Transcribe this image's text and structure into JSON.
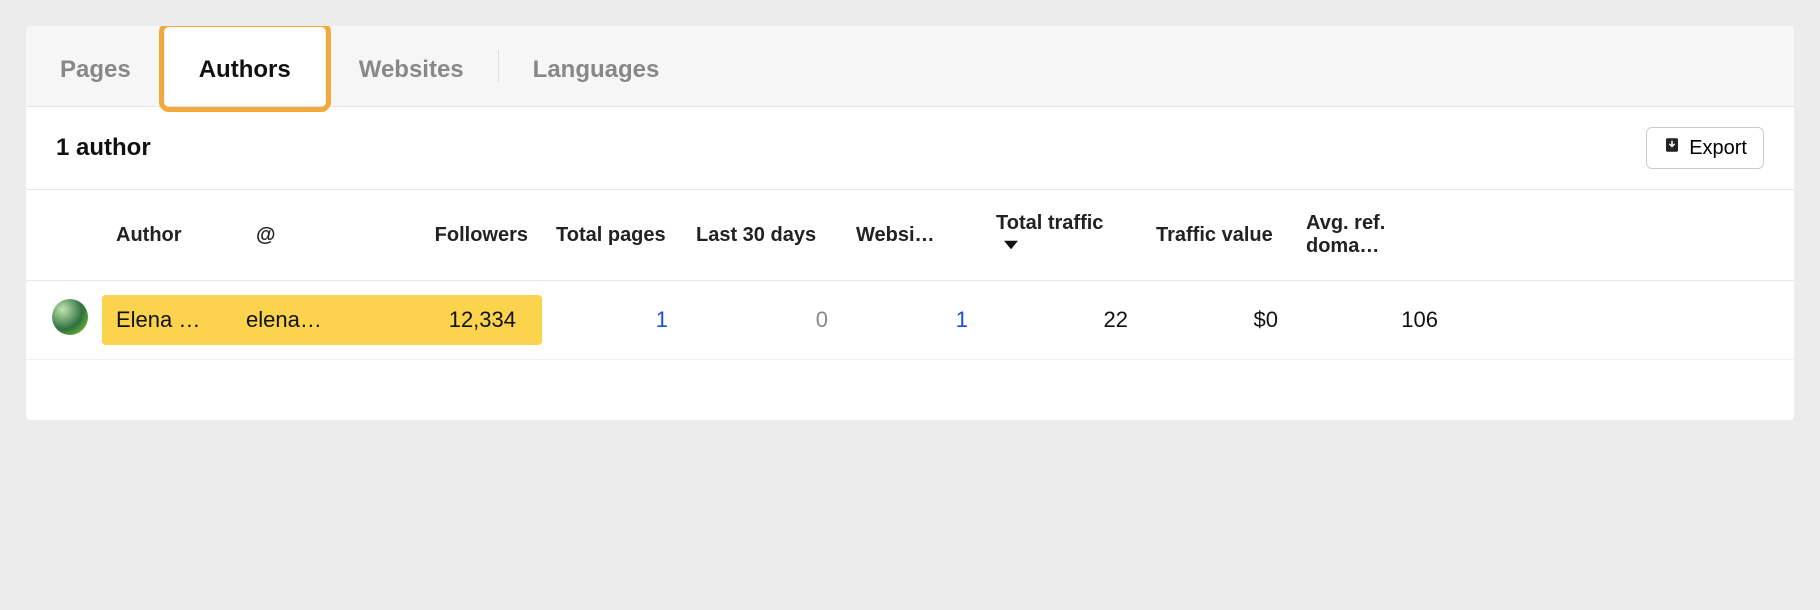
{
  "tabs": {
    "pages": "Pages",
    "authors": "Authors",
    "websites": "Websites",
    "languages": "Languages",
    "active": "authors"
  },
  "subheader": {
    "title": "1 author",
    "export_label": "Export"
  },
  "columns": {
    "author": "Author",
    "handle": "@",
    "followers": "Followers",
    "total_pages": "Total pages",
    "last_30": "Last 30 days",
    "websites": "Websi…",
    "total_traffic": "Total traffic",
    "traffic_value": "Traffic value",
    "avg_ref_domains": "Avg. ref. doma…"
  },
  "sort": {
    "column": "total_traffic",
    "dir": "desc"
  },
  "rows": [
    {
      "author": "Elena …",
      "handle": "elena…",
      "followers": "12,334",
      "total_pages": "1",
      "last_30": "0",
      "websites": "1",
      "total_traffic": "22",
      "traffic_value": "$0",
      "avg_ref_domains": "106"
    }
  ]
}
